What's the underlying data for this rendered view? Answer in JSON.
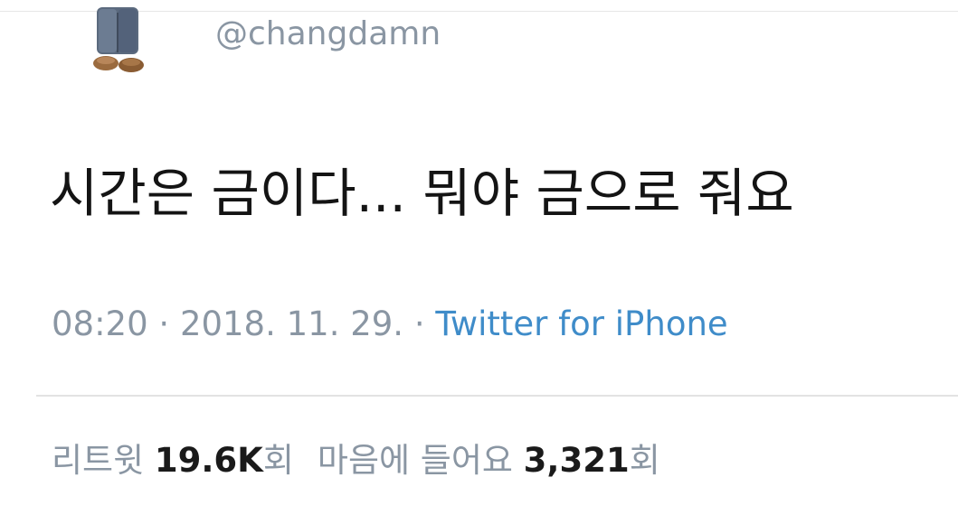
{
  "user": {
    "handle": "@changdamn"
  },
  "tweet": {
    "text": "시간은 금이다... 뭐야 금으로 줘요"
  },
  "meta": {
    "time": "08:20",
    "separator1": " · ",
    "date": "2018. 11. 29.",
    "separator2": " · ",
    "source": "Twitter for iPhone"
  },
  "stats": {
    "retweets_label": "리트윗 ",
    "retweets_count": "19.6K",
    "retweets_unit": "회",
    "likes_label": "마음에 들어요 ",
    "likes_count": "3,321",
    "likes_unit": "회"
  },
  "colors": {
    "muted_text": "#8a96a3",
    "link": "#3f8cc9",
    "body_text": "#141414"
  }
}
